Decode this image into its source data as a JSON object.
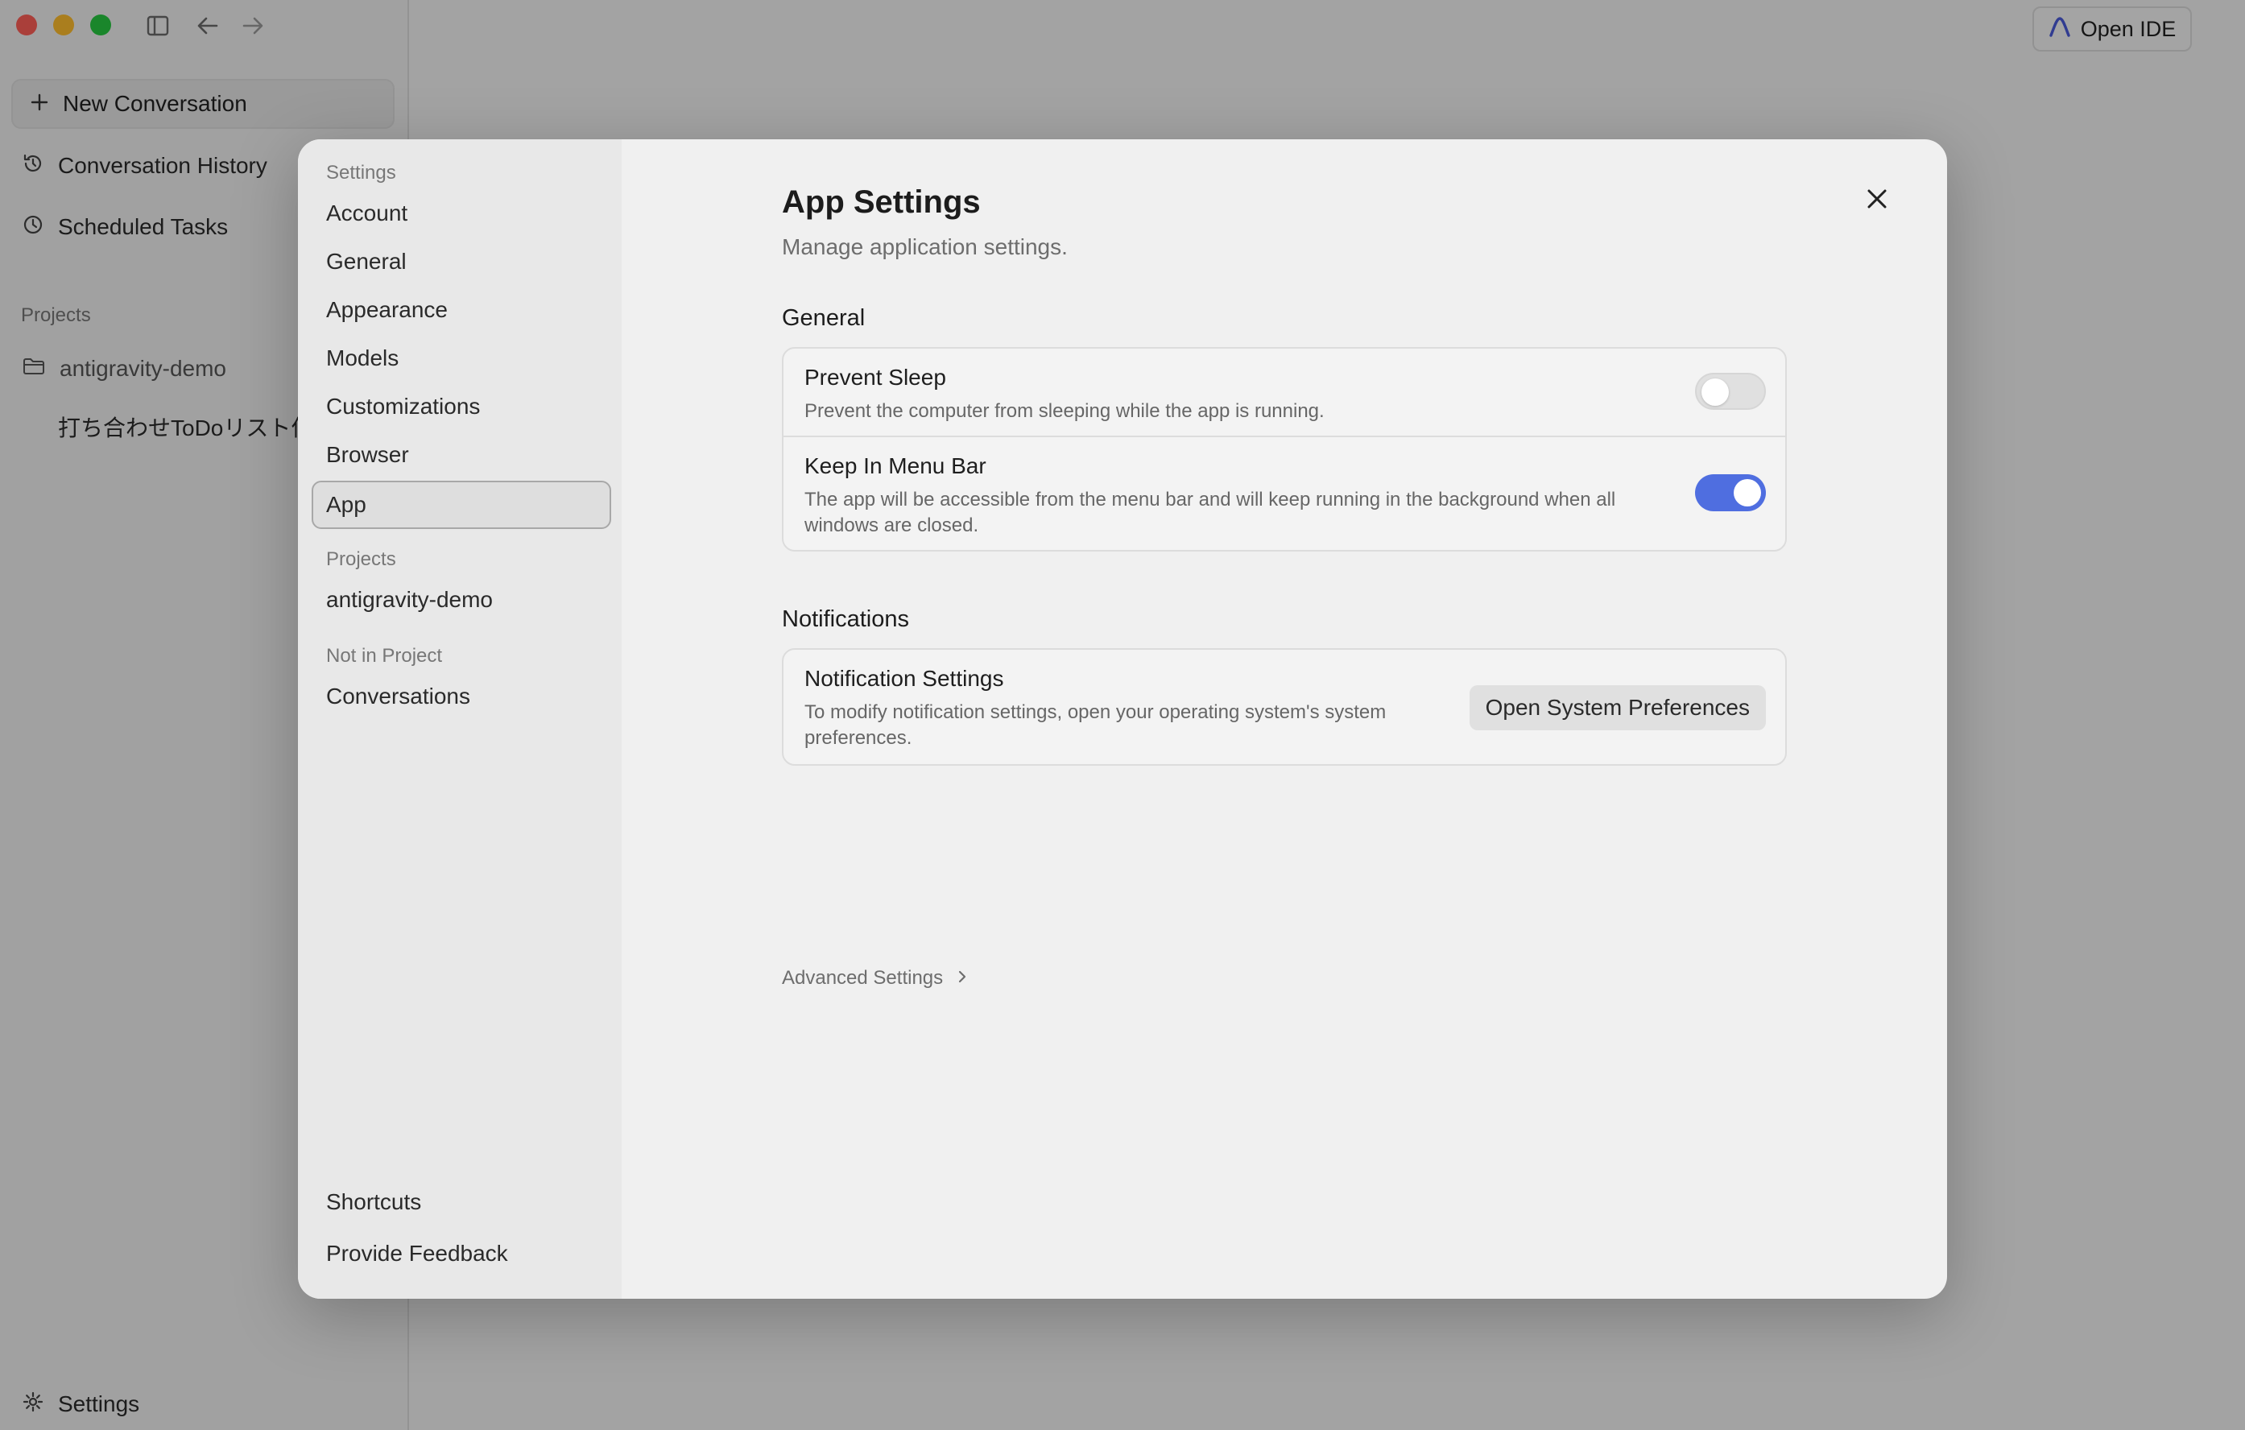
{
  "sidebar": {
    "new_conversation": "New Conversation",
    "conversation_history": "Conversation History",
    "scheduled_tasks": "Scheduled Tasks",
    "projects_heading": "Projects",
    "project_name": "antigravity-demo",
    "conversation_item": "打ち合わせToDoリスト作",
    "settings": "Settings"
  },
  "header": {
    "open_ide": "Open IDE"
  },
  "settings_nav": {
    "section_settings": "Settings",
    "items": [
      "Account",
      "General",
      "Appearance",
      "Models",
      "Customizations",
      "Browser",
      "App"
    ],
    "section_projects": "Projects",
    "project": "antigravity-demo",
    "section_not_in_project": "Not in Project",
    "conversations": "Conversations",
    "shortcuts": "Shortcuts",
    "feedback": "Provide Feedback",
    "active_item": "App"
  },
  "app_settings": {
    "title": "App Settings",
    "subtitle": "Manage application settings.",
    "general_heading": "General",
    "prevent_sleep": {
      "title": "Prevent Sleep",
      "description": "Prevent the computer from sleeping while the app is running.",
      "enabled": false
    },
    "keep_in_menu_bar": {
      "title": "Keep In Menu Bar",
      "description": "The app will be accessible from the menu bar and will keep running in the background when all windows are closed.",
      "enabled": true
    },
    "notifications_heading": "Notifications",
    "notification_settings": {
      "title": "Notification Settings",
      "description": "To modify notification settings, open your operating system's system preferences.",
      "button": "Open System Preferences"
    },
    "advanced": "Advanced Settings"
  },
  "colors": {
    "accent": "#4f6ee0",
    "overlay": "#00000055"
  },
  "icons": [
    "sidebar-toggle-icon",
    "back-arrow-icon",
    "forward-arrow-icon",
    "plus-icon",
    "history-icon",
    "clock-icon",
    "folder-icon",
    "gear-icon",
    "antigravity-logo-icon",
    "close-icon",
    "chevron-right-icon"
  ]
}
